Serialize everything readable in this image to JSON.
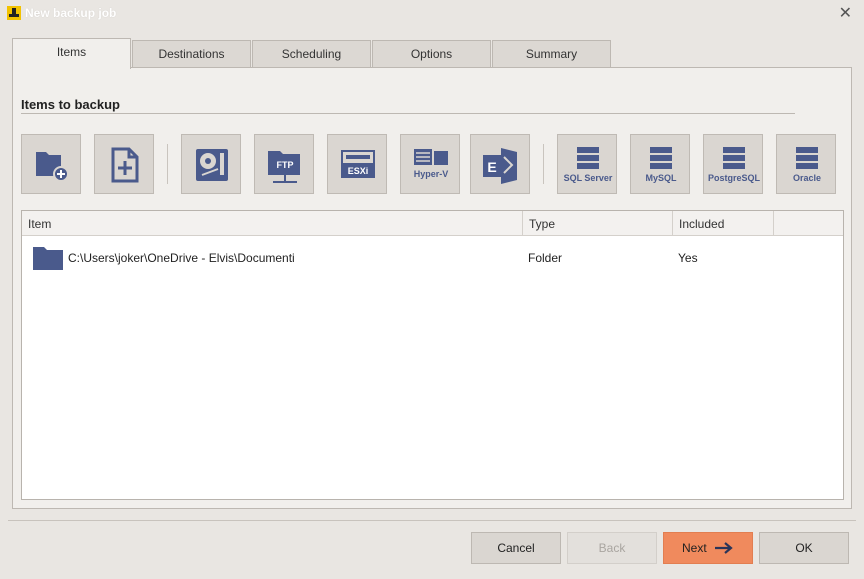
{
  "window": {
    "title": "New backup job",
    "close_glyph": "✕"
  },
  "tabs": [
    {
      "label": "Items"
    },
    {
      "label": "Destinations"
    },
    {
      "label": "Scheduling"
    },
    {
      "label": "Options"
    },
    {
      "label": "Summary"
    }
  ],
  "section": {
    "title": "Items to backup"
  },
  "toolbar": {
    "buttons": [
      {
        "icon": "add-folder-icon"
      },
      {
        "icon": "add-file-icon"
      },
      {
        "icon": "disk-image-icon"
      },
      {
        "icon": "ftp-icon",
        "label": "FTP"
      },
      {
        "icon": "esxi-icon",
        "label": "ESXi"
      },
      {
        "icon": "hyper-v-icon",
        "label": "Hyper-V"
      },
      {
        "icon": "exchange-icon",
        "label": "E"
      },
      {
        "icon": "database-icon",
        "label": "SQL Server"
      },
      {
        "icon": "database-icon",
        "label": "MySQL"
      },
      {
        "icon": "database-icon",
        "label": "PostgreSQL"
      },
      {
        "icon": "database-icon",
        "label": "Oracle"
      }
    ]
  },
  "grid": {
    "columns": [
      "Item",
      "Type",
      "Included"
    ],
    "rows": [
      {
        "item": "C:\\Users\\joker\\OneDrive - Elvis\\Documenti",
        "type": "Folder",
        "included": "Yes"
      }
    ]
  },
  "footer": {
    "cancel": "Cancel",
    "back": "Back",
    "next": "Next",
    "ok": "OK"
  },
  "colors": {
    "icon_blue": "#4a5a8c",
    "next_button": "#f08a5d"
  }
}
